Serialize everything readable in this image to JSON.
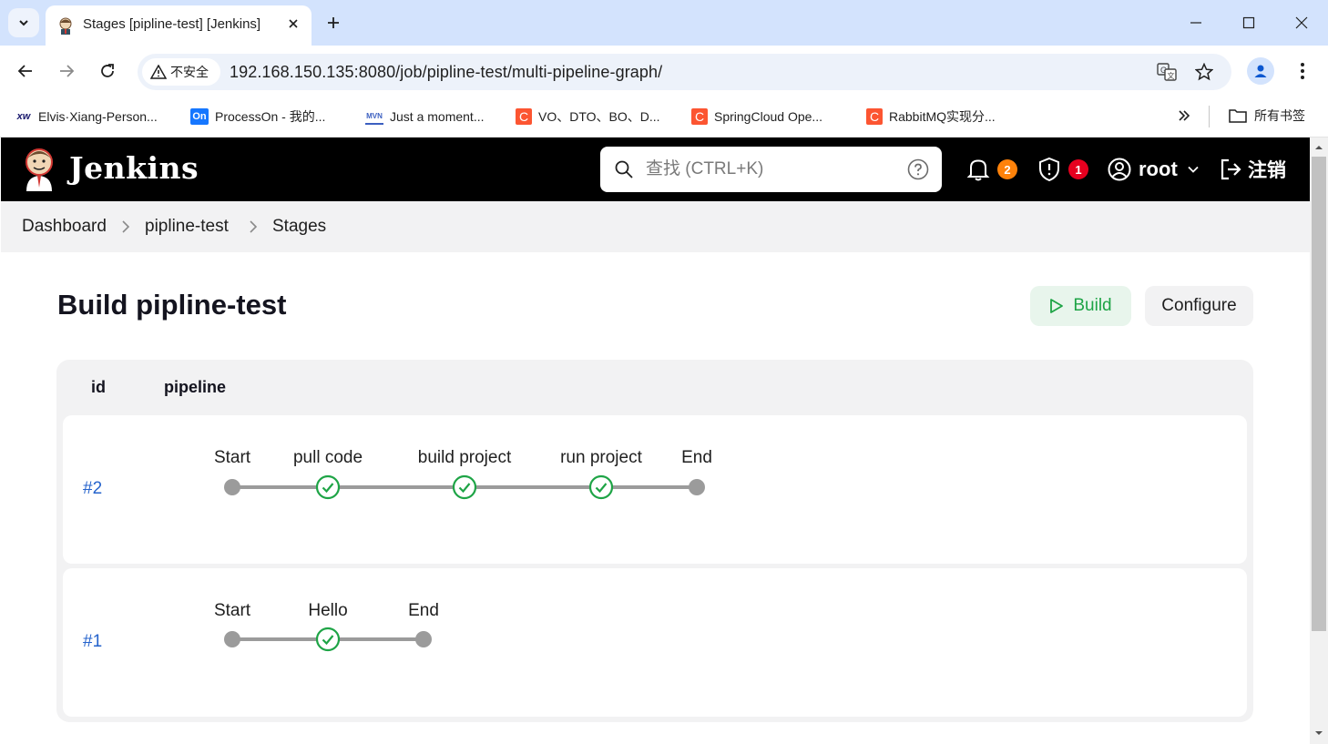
{
  "browser": {
    "tab_title": "Stages [pipline-test] [Jenkins]",
    "security_label": "不安全",
    "url": "192.168.150.135:8080/job/pipline-test/multi-pipeline-graph/",
    "bookmarks": [
      {
        "icon_text": "xw",
        "label": "Elvis·Xiang-Person...",
        "color": "#1a1a6e"
      },
      {
        "icon_text": "On",
        "label": "ProcessOn - 我的...",
        "color": "#1677ff"
      },
      {
        "icon_text": "MVN",
        "label": "Just a moment...",
        "color": "#3b5fc0"
      },
      {
        "icon_text": "C",
        "label": "VO、DTO、BO、D...",
        "color": "#fc5531"
      },
      {
        "icon_text": "C",
        "label": "SpringCloud Ope...",
        "color": "#fc5531"
      },
      {
        "icon_text": "C",
        "label": "RabbitMQ实现分...",
        "color": "#fc5531"
      }
    ],
    "bookmarks_folder": "所有书签"
  },
  "jenkins": {
    "brand": "Jenkins",
    "search_placeholder": "查找 (CTRL+K)",
    "notifications_count": "2",
    "security_count": "1",
    "user": "root",
    "logout": "注销",
    "colors": {
      "header_bg": "#000000",
      "notify_badge": "#fe820a",
      "security_badge": "#e6001f",
      "success": "#1ea446"
    }
  },
  "breadcrumb": [
    "Dashboard",
    "pipline-test",
    "Stages"
  ],
  "page": {
    "title": "Build pipline-test",
    "build_label": "Build",
    "configure_label": "Configure"
  },
  "table": {
    "headers": [
      "id",
      "pipeline"
    ],
    "runs": [
      {
        "id": "#2",
        "stages": [
          {
            "name": "Start",
            "status": "node"
          },
          {
            "name": "pull code",
            "status": "success"
          },
          {
            "name": "build project",
            "status": "success"
          },
          {
            "name": "run project",
            "status": "success"
          },
          {
            "name": "End",
            "status": "node"
          }
        ]
      },
      {
        "id": "#1",
        "stages": [
          {
            "name": "Start",
            "status": "node"
          },
          {
            "name": "Hello",
            "status": "success"
          },
          {
            "name": "End",
            "status": "node"
          }
        ]
      }
    ]
  }
}
